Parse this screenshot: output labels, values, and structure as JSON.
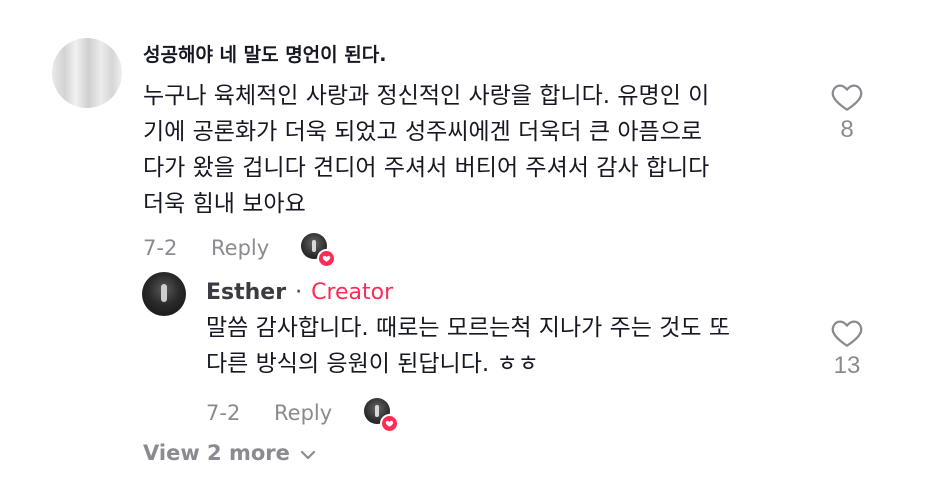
{
  "comment": {
    "username": "성공해야 네 말도 명언이 된다.",
    "lines": [
      "누구나 육체적인 사랑과 정신적인 사랑을 합니다. 유명인 이",
      "기에 공론화가 더욱 되었고 성주씨에겐 더욱더 큰 아픔으로",
      "다가 왔을 겁니다 견디어 주셔서 버티어 주셔서 감사 합니다",
      "더욱 힘내 보아요"
    ],
    "date": "7-2",
    "reply_label": "Reply",
    "like_count": "8",
    "like_icon": "heart-outline-icon"
  },
  "reply": {
    "username": "Esther",
    "separator": "·",
    "badge": "Creator",
    "lines": [
      "말씀 감사합니다. 때로는 모르는척 지나가 주는 것도 또",
      "다른 방식의 응원이 된답니다. ㅎㅎ"
    ],
    "date": "7-2",
    "reply_label": "Reply",
    "like_count": "13",
    "like_icon": "heart-outline-icon"
  },
  "view_more": {
    "label": "View 2 more",
    "icon": "chevron-down-icon"
  },
  "colors": {
    "text": "#161823",
    "muted": "#8a8b91",
    "creator": "#fe2c55"
  }
}
